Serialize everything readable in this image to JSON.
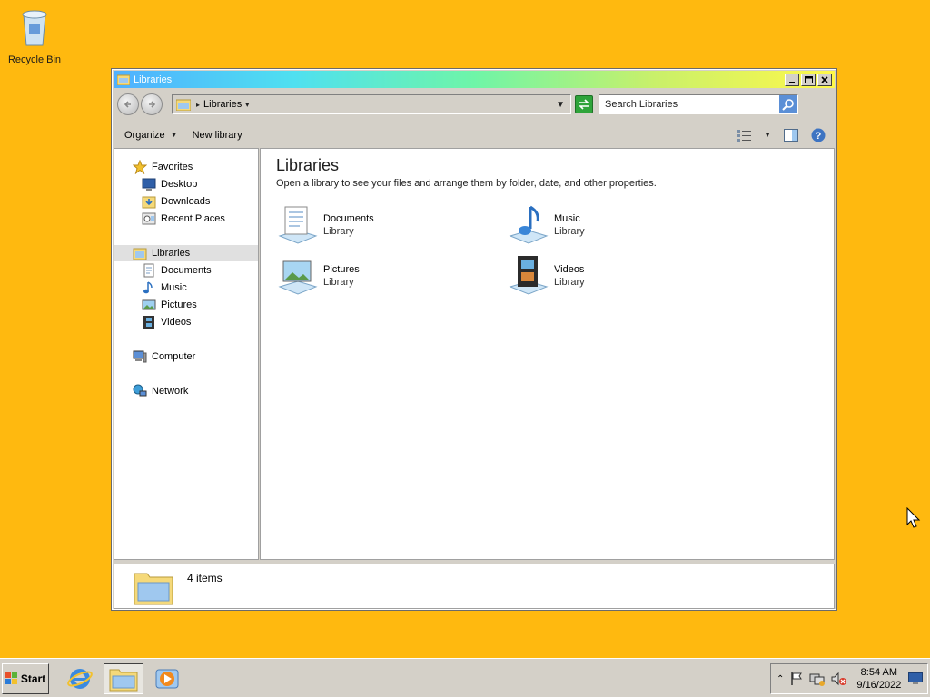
{
  "desktop": {
    "icons": [
      {
        "label": "Recycle Bin"
      }
    ]
  },
  "window": {
    "title": "Libraries",
    "address": {
      "path": "Libraries"
    },
    "search": {
      "placeholder": "Search Libraries"
    },
    "toolbar": {
      "organize_label": "Organize",
      "new_library_label": "New library"
    },
    "nav": {
      "favorites": {
        "label": "Favorites",
        "items": [
          "Desktop",
          "Downloads",
          "Recent Places"
        ]
      },
      "libraries": {
        "label": "Libraries",
        "items": [
          "Documents",
          "Music",
          "Pictures",
          "Videos"
        ]
      },
      "computer": "Computer",
      "network": "Network"
    },
    "content": {
      "title": "Libraries",
      "subtitle": "Open a library to see your files and arrange them by folder, date, and other properties.",
      "libraries": [
        {
          "name": "Documents",
          "type": "Library"
        },
        {
          "name": "Music",
          "type": "Library"
        },
        {
          "name": "Pictures",
          "type": "Library"
        },
        {
          "name": "Videos",
          "type": "Library"
        }
      ]
    },
    "details": {
      "count_text": "4 items"
    }
  },
  "taskbar": {
    "start_label": "Start",
    "clock": {
      "time": "8:54 AM",
      "date": "9/16/2022"
    }
  },
  "colors": {
    "desktop": "#ffb90f",
    "chrome": "#d4d0c8",
    "accent": "#4fb0ff"
  }
}
